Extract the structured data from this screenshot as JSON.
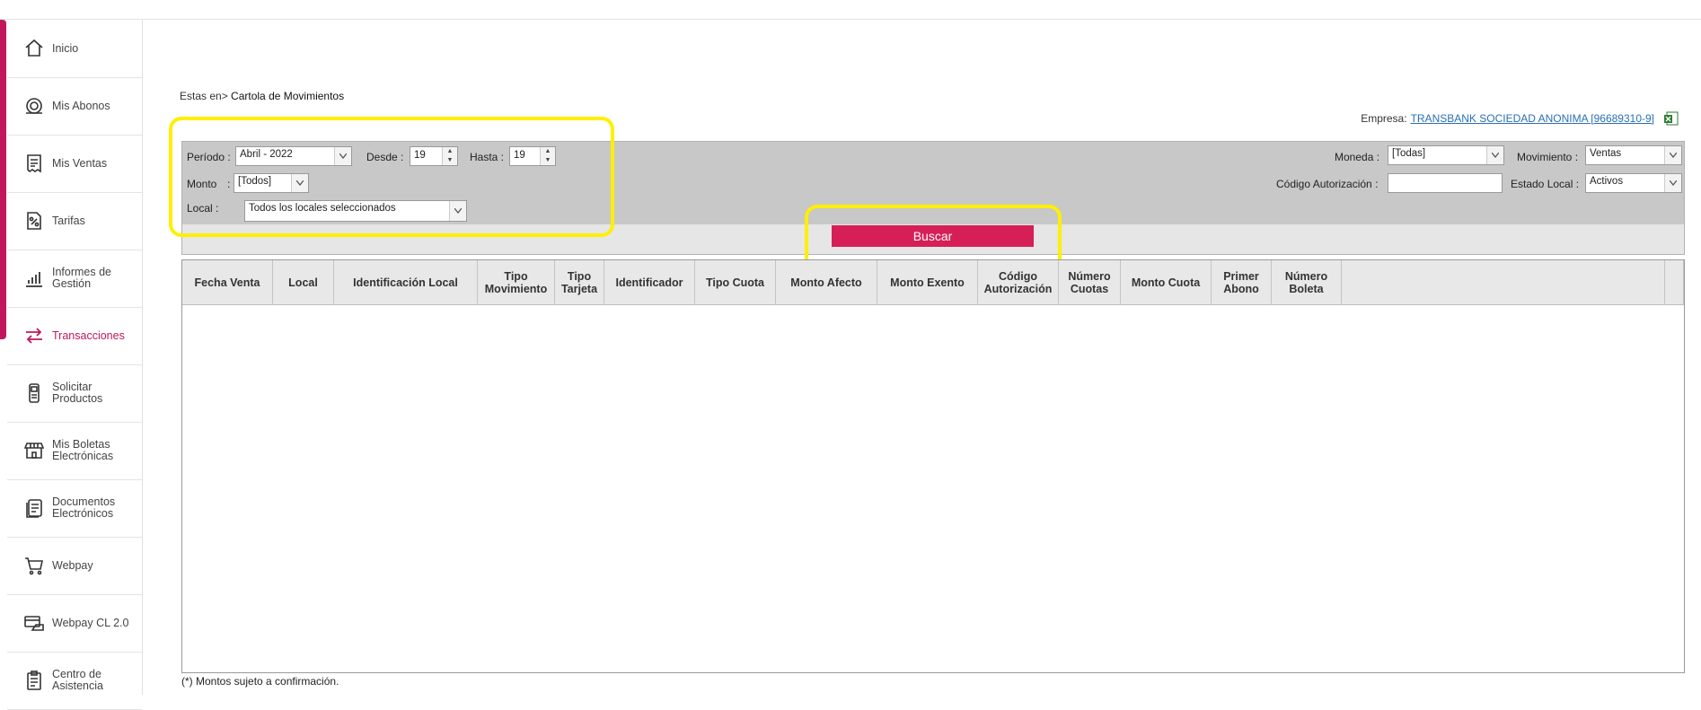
{
  "sidebar": {
    "items": [
      {
        "label": "Inicio",
        "icon": "home-icon"
      },
      {
        "label": "Mis Abonos",
        "icon": "coin-icon"
      },
      {
        "label": "Mis Ventas",
        "icon": "receipt-icon"
      },
      {
        "label": "Tarifas",
        "icon": "percent-icon"
      },
      {
        "label": "Informes de Gestión",
        "icon": "bar-chart-icon"
      },
      {
        "label": "Transacciones",
        "icon": "transfer-arrows-icon"
      },
      {
        "label": "Solicitar Productos",
        "icon": "pos-terminal-icon"
      },
      {
        "label": "Mis Boletas Electrónicas",
        "icon": "store-icon"
      },
      {
        "label": "Documentos Electrónicos",
        "icon": "document-icon"
      },
      {
        "label": "Webpay",
        "icon": "cart-icon"
      },
      {
        "label": "Webpay CL 2.0",
        "icon": "card-payment-icon"
      },
      {
        "label": "Centro de Asistencia",
        "icon": "clipboard-icon"
      }
    ],
    "active": "Transacciones",
    "accent_color": "#c2185b"
  },
  "breadcrumb": {
    "prefix": "Estas en>",
    "current": "Cartola de Movimientos"
  },
  "empresa": {
    "label": "Empresa:",
    "value": "TRANSBANK SOCIEDAD ANONIMA [96689310-9]",
    "export_icon": "excel-icon"
  },
  "filters": {
    "periodo": {
      "label": "Período :",
      "value": "Abril - 2022"
    },
    "desde": {
      "label": "Desde :",
      "value": "19"
    },
    "hasta": {
      "label": "Hasta :",
      "value": "19"
    },
    "monto": {
      "label": "Monto",
      "colon": ":",
      "value": "[Todos]"
    },
    "local": {
      "label": "Local :",
      "value": "Todos los locales seleccionados"
    },
    "moneda": {
      "label": "Moneda :",
      "value": "[Todas]"
    },
    "movimiento": {
      "label": "Movimiento :",
      "value": "Ventas"
    },
    "codigo_autorizacion": {
      "label": "Código Autorización :",
      "value": ""
    },
    "estado_local": {
      "label": "Estado Local :",
      "value": "Activos"
    }
  },
  "search_button": {
    "label": "Buscar",
    "color": "#d61f56"
  },
  "table": {
    "columns": [
      "Fecha Venta",
      "Local",
      "Identificación Local",
      "Tipo Movimiento",
      "Tipo Tarjeta",
      "Identificador",
      "Tipo Cuota",
      "Monto Afecto",
      "Monto Exento",
      "Código Autorización",
      "Número Cuotas",
      "Monto Cuota",
      "Primer Abono",
      "Número Boleta"
    ],
    "rows": []
  },
  "footnote": "(*) Montos sujeto a confirmación.",
  "highlight_color": "#ffef00"
}
